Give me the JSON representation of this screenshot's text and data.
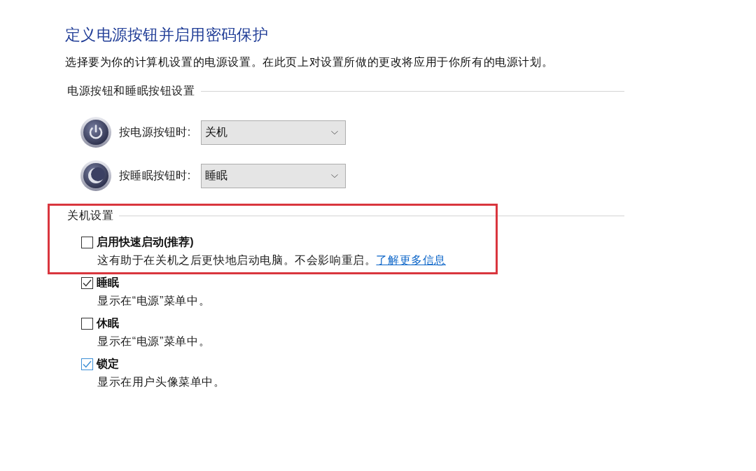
{
  "title": "定义电源按钮并启用密码保护",
  "description": "选择要为你的计算机设置的电源设置。在此页上对设置所做的更改将应用于你所有的电源计划。",
  "button_settings": {
    "heading": "电源按钮和睡眠按钮设置",
    "rows": [
      {
        "kind": "power",
        "label": "按电源按钮时:",
        "value": "关机"
      },
      {
        "kind": "sleep",
        "label": "按睡眠按钮时:",
        "value": "睡眠"
      }
    ]
  },
  "shutdown_settings": {
    "heading": "关机设置",
    "highlighted": true,
    "options": [
      {
        "label": "启用快速启动(推荐)",
        "checked": false,
        "color": "#333333",
        "description": "这有助于在关机之后更快地启动电脑。不会影响重启。",
        "link": "了解更多信息"
      },
      {
        "label": "睡眠",
        "checked": true,
        "color": "#333333",
        "description": "显示在“电源”菜单中。"
      },
      {
        "label": "休眠",
        "checked": false,
        "color": "#333333",
        "description": "显示在“电源”菜单中。"
      },
      {
        "label": "锁定",
        "checked": true,
        "color": "#3c8fd6",
        "description": "显示在用户头像菜单中。"
      }
    ]
  }
}
